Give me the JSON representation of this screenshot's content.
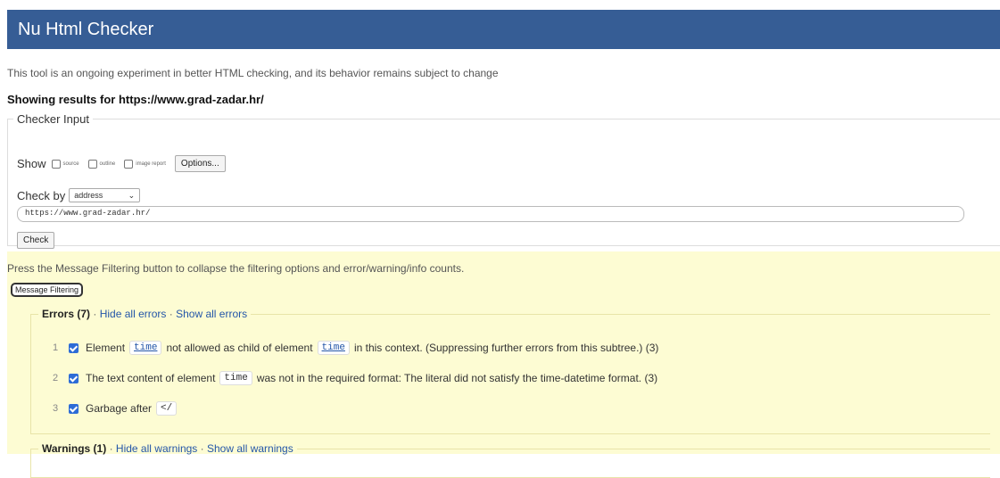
{
  "header": {
    "title": "Nu Html Checker"
  },
  "tagline": "This tool is an ongoing experiment in better HTML checking, and its behavior remains subject to change",
  "showing": {
    "label": "Showing results for",
    "url": "https://www.grad-zadar.hr/"
  },
  "checker_input": {
    "legend": "Checker Input",
    "show_label": "Show",
    "options": [
      {
        "label": "source",
        "checked": false
      },
      {
        "label": "outline",
        "checked": false
      },
      {
        "label": "image report",
        "checked": false
      }
    ],
    "options_button": "Options...",
    "check_by_label": "Check by",
    "check_by_value": "address",
    "url_value": "https://www.grad-zadar.hr/",
    "check_button": "Check"
  },
  "filtering": {
    "text": "Press the Message Filtering button to collapse the filtering options and error/warning/info counts.",
    "button": "Message Filtering"
  },
  "errors": {
    "title": "Errors (7)",
    "hide": "Hide all errors",
    "show": "Show all errors",
    "separator": "·",
    "items": [
      {
        "n": "1",
        "pre": "Element",
        "code1": "time",
        "mid": "not allowed as child of element",
        "code2": "time",
        "post": "in this context. (Suppressing further errors from this subtree.) (3)"
      },
      {
        "n": "2",
        "pre": "The text content of element",
        "code1": "time",
        "post": "was not in the required format: The literal did not satisfy the time-datetime format. (3)"
      },
      {
        "n": "3",
        "pre": "Garbage after",
        "code1": "</"
      }
    ]
  },
  "warnings": {
    "title": "Warnings (1)",
    "hide": "Hide all warnings",
    "show": "Show all warnings"
  },
  "colors": {
    "header_bg": "#365d95",
    "filter_bg": "#fdfcd3",
    "link": "#2456a8",
    "checkbox": "#2d6cd6"
  }
}
